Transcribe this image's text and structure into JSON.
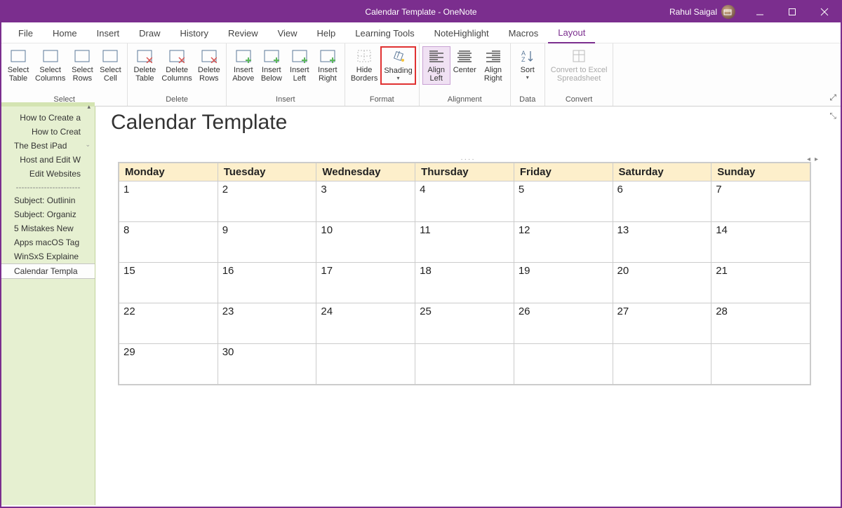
{
  "window": {
    "title": "Calendar Template  -  OneNote",
    "user": "Rahul Saigal"
  },
  "menubar": {
    "tabs": [
      "File",
      "Home",
      "Insert",
      "Draw",
      "History",
      "Review",
      "View",
      "Help",
      "Learning Tools",
      "NoteHighlight",
      "Macros",
      "Layout"
    ],
    "active": "Layout"
  },
  "ribbon": {
    "groups": [
      {
        "label": "Select",
        "buttons": [
          {
            "name": "select-table",
            "label": "Select\nTable"
          },
          {
            "name": "select-columns",
            "label": "Select\nColumns"
          },
          {
            "name": "select-rows",
            "label": "Select\nRows"
          },
          {
            "name": "select-cell",
            "label": "Select\nCell"
          }
        ]
      },
      {
        "label": "Delete",
        "buttons": [
          {
            "name": "delete-table",
            "label": "Delete\nTable"
          },
          {
            "name": "delete-columns",
            "label": "Delete\nColumns"
          },
          {
            "name": "delete-rows",
            "label": "Delete\nRows"
          }
        ]
      },
      {
        "label": "Insert",
        "buttons": [
          {
            "name": "insert-above",
            "label": "Insert\nAbove"
          },
          {
            "name": "insert-below",
            "label": "Insert\nBelow"
          },
          {
            "name": "insert-left",
            "label": "Insert\nLeft"
          },
          {
            "name": "insert-right",
            "label": "Insert\nRight"
          }
        ]
      },
      {
        "label": "Format",
        "buttons": [
          {
            "name": "hide-borders",
            "label": "Hide\nBorders"
          },
          {
            "name": "shading",
            "label": "Shading",
            "dropdown": true,
            "highlighted": true
          }
        ]
      },
      {
        "label": "Alignment",
        "buttons": [
          {
            "name": "align-left",
            "label": "Align\nLeft",
            "active": true
          },
          {
            "name": "center",
            "label": "Center"
          },
          {
            "name": "align-right",
            "label": "Align\nRight"
          }
        ]
      },
      {
        "label": "Data",
        "buttons": [
          {
            "name": "sort",
            "label": "Sort",
            "dropdown": true
          }
        ]
      },
      {
        "label": "Convert",
        "buttons": [
          {
            "name": "convert-excel",
            "label": "Convert to Excel\nSpreadsheet",
            "disabled": true
          }
        ]
      }
    ]
  },
  "sidebar": {
    "items": [
      {
        "label": "How to Create a",
        "align": "right"
      },
      {
        "label": "How to Creat",
        "align": "right"
      },
      {
        "label": "The Best iPad",
        "chevron": true
      },
      {
        "label": "Host and Edit W",
        "align": "right"
      },
      {
        "label": "Edit Websites",
        "align": "right"
      },
      {
        "label": "-----------------------",
        "sep": true
      },
      {
        "label": "Subject: Outlinin"
      },
      {
        "label": "Subject: Organiz"
      },
      {
        "label": "5 Mistakes New"
      },
      {
        "label": "Apps macOS Tag"
      },
      {
        "label": "WinSxS Explaine"
      },
      {
        "label": "Calendar Templa",
        "selected": true
      }
    ]
  },
  "page": {
    "title": "Calendar Template",
    "calendar": {
      "headers": [
        "Monday",
        "Tuesday",
        "Wednesday",
        "Thursday",
        "Friday",
        "Saturday",
        "Sunday"
      ],
      "rows": [
        [
          "1",
          "2",
          "3",
          "4",
          "5",
          "6",
          "7"
        ],
        [
          "8",
          "9",
          "10",
          "11",
          "12",
          "13",
          "14"
        ],
        [
          "15",
          "16",
          "17",
          "18",
          "19",
          "20",
          "21"
        ],
        [
          "22",
          "23",
          "24",
          "25",
          "26",
          "27",
          "28"
        ],
        [
          "29",
          "30",
          "",
          "",
          "",
          "",
          ""
        ]
      ]
    }
  }
}
